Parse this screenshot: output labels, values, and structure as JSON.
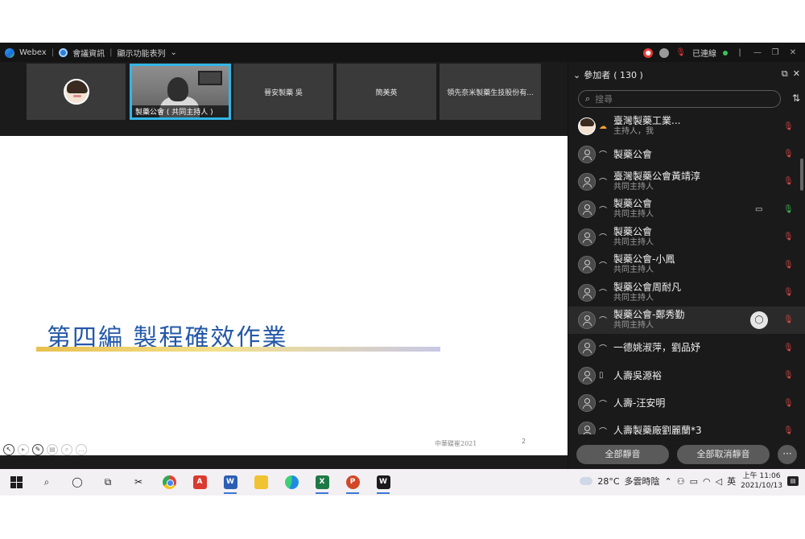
{
  "titlebar": {
    "app": "Webex",
    "meeting_info": "會議資訊",
    "view_menu": "顯示功能表列",
    "connection": "已連線"
  },
  "thumbnails": [
    {
      "label": ""
    },
    {
      "label": "製藥公會 ( 共同主持人 )"
    },
    {
      "label": "晉安製藥 吳"
    },
    {
      "label": "簡美英"
    },
    {
      "label": "領先奈米製藥生技股份有..."
    }
  ],
  "slide": {
    "title": "第四編  製程確效作業",
    "footer": "中華碟崔2021",
    "page": "2"
  },
  "panel": {
    "title": "參加者",
    "count": "( 130 )",
    "search_placeholder": "搜尋",
    "mute_all": "全部靜音",
    "unmute_all": "全部取消靜音",
    "more": "···"
  },
  "participants": [
    {
      "name": "臺灣製藥工業...",
      "role": "主持人，我",
      "mic": "muted",
      "host": true
    },
    {
      "name": "製藥公會",
      "role": "",
      "mic": "muted"
    },
    {
      "name": "臺灣製藥公會黃靖淳",
      "role": "共同主持人",
      "mic": "muted"
    },
    {
      "name": "製藥公會",
      "role": "共同主持人",
      "mic": "on",
      "camera": true
    },
    {
      "name": "製藥公會",
      "role": "共同主持人",
      "mic": "muted"
    },
    {
      "name": "製藥公會-小鳳",
      "role": "共同主持人",
      "mic": "muted"
    },
    {
      "name": "製藥公會周耐凡",
      "role": "共同主持人",
      "mic": "muted"
    },
    {
      "name": "製藥公會-鄭秀勤",
      "role": "共同主持人",
      "mic": "muted",
      "chat": true,
      "highlighted": true
    },
    {
      "name": "一德姚淑萍，劉品妤",
      "role": "",
      "mic": "muted"
    },
    {
      "name": "人壽吳源裕",
      "role": "",
      "mic": "muted"
    },
    {
      "name": "人壽-汪安明",
      "role": "",
      "mic": "muted"
    },
    {
      "name": "人壽製藥廠劉麗蘭*3",
      "role": "",
      "mic": "muted"
    }
  ],
  "taskbar": {
    "temperature": "28°C",
    "weather": "多雲時陰",
    "ime": "英",
    "time": "上午 11:06",
    "date": "2021/10/13"
  }
}
